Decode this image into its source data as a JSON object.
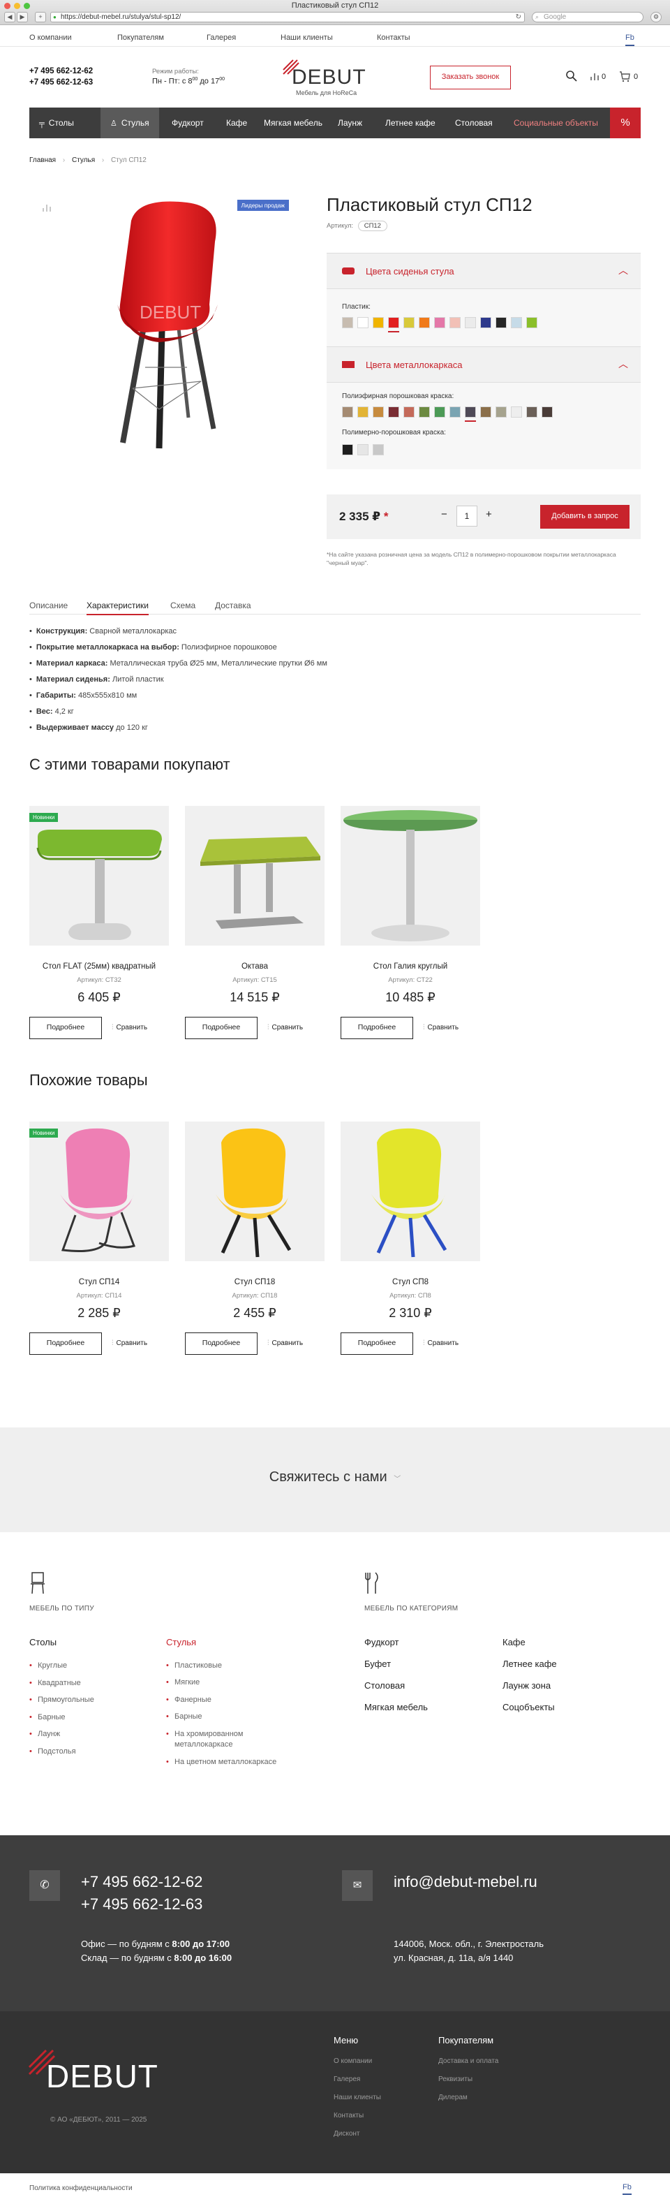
{
  "browser": {
    "title": "Пластиковый стул СП12",
    "url": "https://debut-mebel.ru/stulya/stul-sp12/",
    "search_placeholder": "Google"
  },
  "topnav": {
    "items": [
      "О компании",
      "Покупателям",
      "Галерея",
      "Наши клиенты",
      "Контакты"
    ],
    "social": "Fb"
  },
  "header": {
    "phone1": "+7 495 662-12-62",
    "phone2": "+7 495 662-12-63",
    "hours_label": "Режим работы:",
    "hours": "Пн - Пт: с 8",
    "hours_sup1": "00",
    "hours_mid": " до 17",
    "hours_sup2": "00",
    "logo": "DEBUT",
    "logo_sub": "Мебель для HoReCa",
    "callback": "Заказать звонок",
    "compare_count": "0",
    "cart_count": "0"
  },
  "mainmenu": {
    "items": [
      "Столы",
      "Стулья",
      "Фудкорт",
      "Кафе",
      "Мягкая мебель",
      "Лаунж",
      "Летнее кафе",
      "Столовая",
      "Социальные объекты"
    ],
    "sale": "%"
  },
  "breadcrumb": [
    "Главная",
    "Стулья",
    "Стул СП12"
  ],
  "product": {
    "badge": "Лидеры продаж",
    "title": "Пластиковый стул СП12",
    "sku_label": "Артикул:",
    "sku": "СП12",
    "seat_colors_title": "Цвета сиденья стула",
    "plastic_label": "Пластик:",
    "plastic_colors": [
      "#c7bcb0",
      "#ffffff",
      "#f0b400",
      "#e21f1f",
      "#d8c93a",
      "#f07a1a",
      "#e478a8",
      "#f2c0b6",
      "#ebebeb",
      "#2e3a8c",
      "#262626",
      "#c6dbe8",
      "#8bbf2a"
    ],
    "frame_colors_title": "Цвета металлокаркаса",
    "powder_label": "Полиэфирная порошковая краска:",
    "powder_colors": [
      "#a58b72",
      "#e2b436",
      "#c78b3e",
      "#7a2d33",
      "#c46a5a",
      "#6c8a40",
      "#4c9a56",
      "#7aa4b2",
      "#4f4a57",
      "#8b6f4a",
      "#a6a38e",
      "#eeeeee",
      "#6b6058",
      "#4a3c38"
    ],
    "poly_label": "Полимерно-порошковая краска:",
    "poly_colors": [
      "#1e1e1e",
      "#e6e6e6",
      "#c8c8c8"
    ],
    "price": "2 335 ₽",
    "price_star": "*",
    "qty": "1",
    "minus": "−",
    "plus": "+",
    "add_button": "Добавить в запрос",
    "note": "*На сайте указана розничная цена за модель СП12 в полимерно-порошковом покрытии металлокаркаса \"черный муар\"."
  },
  "tabs": [
    "Описание",
    "Характеристики",
    "Схема",
    "Доставка"
  ],
  "specs": [
    {
      "k": "Конструкция:",
      "v": " Сварной металлокаркас"
    },
    {
      "k": "Покрытие металлокаркаса на выбор:",
      "v": " Полиэфирное порошковое"
    },
    {
      "k": "Материал каркаса:",
      "v": " Металлическая труба Ø25 мм, Металлические прутки Ø6 мм"
    },
    {
      "k": "Материал сиденья:",
      "v": " Литой пластик"
    },
    {
      "k": "Габариты:",
      "v": " 485х555х810 мм"
    },
    {
      "k": "Вес:",
      "v": " 4,2 кг"
    },
    {
      "k": "Выдерживает массу",
      "v": " до 120 кг"
    }
  ],
  "also": {
    "title": "С этими товарами покупают",
    "items": [
      {
        "name": "Стол FLAT (25мм) квадратный",
        "sku": "Артикул: СТ32",
        "price": "6 405 ₽",
        "badge": "Новинки"
      },
      {
        "name": "Октава",
        "sku": "Артикул: СТ15",
        "price": "14 515 ₽",
        "badge": ""
      },
      {
        "name": "Стол Галия круглый",
        "sku": "Артикул: СТ22",
        "price": "10 485 ₽",
        "badge": ""
      }
    ]
  },
  "similar": {
    "title": "Похожие товары",
    "items": [
      {
        "name": "Стул СП14",
        "sku": "Артикул: СП14",
        "price": "2 285 ₽",
        "badge": "Новинки"
      },
      {
        "name": "Стул СП18",
        "sku": "Артикул: СП18",
        "price": "2 455 ₽",
        "badge": ""
      },
      {
        "name": "Стул СП8",
        "sku": "Артикул: СП8",
        "price": "2 310 ₽",
        "badge": ""
      }
    ]
  },
  "card_buttons": {
    "details": "Подробнее",
    "compare": "Сравнить"
  },
  "contact_us": "Свяжитесь с нами",
  "footer_nav": {
    "type_heading": "МЕБЕЛЬ ПО ТИПУ",
    "cat_heading": "МЕБЕЛЬ ПО КАТЕГОРИЯМ",
    "tables_title": "Столы",
    "tables": [
      "Круглые",
      "Квадратные",
      "Прямоугольные",
      "Барные",
      "Лаунж",
      "Подстолья"
    ],
    "chairs_title": "Стулья",
    "chairs": [
      "Пластиковые",
      "Мягкие",
      "Фанерные",
      "Барные",
      "На хромированном металлокаркасе",
      "На цветном металлокаркасе"
    ],
    "cat_col1": [
      "Фудкорт",
      "Буфет",
      "Столовая",
      "Мягкая мебель"
    ],
    "cat_col2": [
      "Кафе",
      "Летнее кафе",
      "Лаунж зона",
      "Соцобъекты"
    ]
  },
  "footer_contacts": {
    "phone1": "+7 495 662-12-62",
    "phone2": "+7 495 662-12-63",
    "office": "Офис — по будням с ",
    "office_time": "8:00 до 17:00",
    "store": "Склад — по будням с ",
    "store_time": "8:00 до 16:00",
    "email": "info@debut-mebel.ru",
    "address1": "144006, Моск. обл., г. Электросталь",
    "address2": "ул. Красная, д. 11а, а/я 1440"
  },
  "footer_bottom": {
    "logo": "DEBUT",
    "copyright": "© АО «ДЕБЮТ», 2011 — 2025",
    "menu_title": "Меню",
    "menu": [
      "О компании",
      "Галерея",
      "Наши клиенты",
      "Контакты",
      "Дисконт"
    ],
    "buyers_title": "Покупателям",
    "buyers": [
      "Доставка и оплата",
      "Реквизиты",
      "Дилерам"
    ]
  },
  "bottom_bar": {
    "privacy": "Политика конфиденциальности",
    "social": "Fb"
  },
  "colors": {
    "accent": "#c8232c",
    "menu_bg": "#3d3d3d",
    "dark_footer": "#3e3e3e",
    "new_badge": "#2daa4f",
    "lead_badge": "#4a6fc9"
  }
}
